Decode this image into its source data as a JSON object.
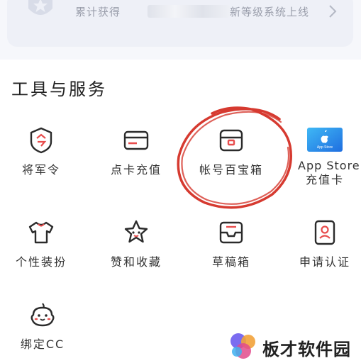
{
  "banner": {
    "text_before": "累计获得",
    "text_after": "新等级系统上线",
    "medal_icon": "medal-icon",
    "chevron_icon": "chevron-right-icon"
  },
  "section": {
    "title": "工具与服务"
  },
  "items": [
    {
      "label": "将军令",
      "icon": "shield-badge-icon"
    },
    {
      "label": "点卡充值",
      "icon": "card-icon"
    },
    {
      "label": "帐号百宝箱",
      "icon": "treasure-box-icon"
    },
    {
      "label_line1": "App Store",
      "label_line2": "充值卡",
      "icon": "app-store-card-icon",
      "icon_text": "App Store"
    },
    {
      "label": "个性装扮",
      "icon": "tshirt-icon"
    },
    {
      "label": "赞和收藏",
      "icon": "star-icon"
    },
    {
      "label": "草稿箱",
      "icon": "drafts-tray-icon"
    },
    {
      "label": "申请认证",
      "icon": "id-badge-icon"
    },
    {
      "label": "绑定CC",
      "icon": "cc-mascot-icon"
    }
  ],
  "annotation": {
    "color": "#d63a30"
  },
  "watermark": {
    "text": "板才软件园"
  },
  "colors": {
    "accent": "#e84d4d",
    "icon_stroke": "#2b2b2b"
  }
}
